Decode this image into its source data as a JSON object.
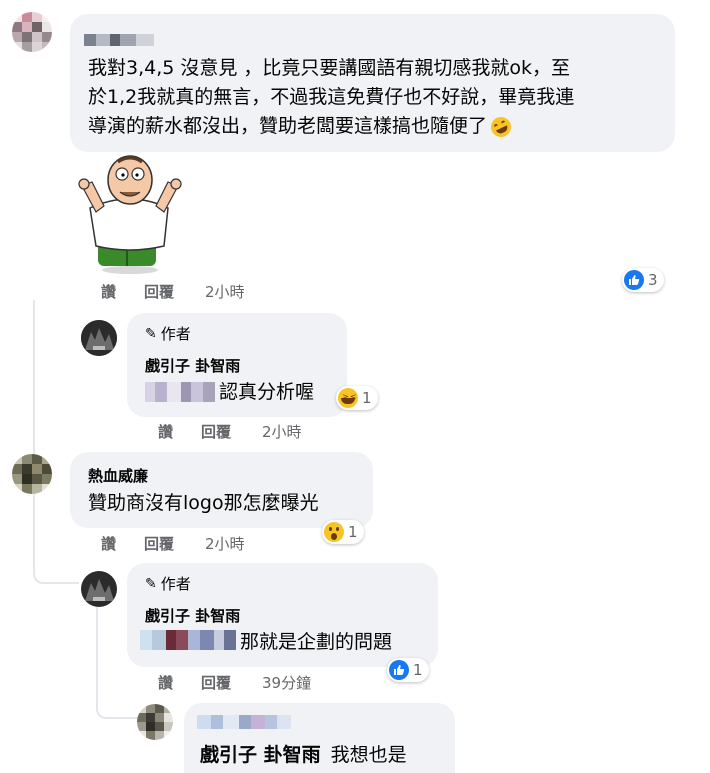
{
  "comments": [
    {
      "name": "",
      "lines": [
        "我對3,4,5 沒意見 ，比竟只要講國語有親切感我就ok，至",
        "於1,2我就真的無言，不過我這免費仔也不好說，畢竟我連",
        "導演的薪水都沒出，贊助老闆要這樣搞也隨便了"
      ],
      "sticker": "peter-griffin-shrug-sticker",
      "like": "讚",
      "reply": "回覆",
      "time": "2小時",
      "reaction_icon": "like-icon",
      "reaction_count": "3"
    },
    {
      "author_tag": "作者",
      "name": "戲引子 卦智雨",
      "text": "認真分析喔",
      "like": "讚",
      "reply": "回覆",
      "time": "2小時",
      "reaction_icon": "laugh-icon",
      "reaction_count": "1"
    },
    {
      "name": "熱血威廉",
      "text": "贊助商沒有logo那怎麼曝光",
      "like": "讚",
      "reply": "回覆",
      "time": "2小時",
      "reaction_icon": "wow-icon",
      "reaction_count": "1"
    },
    {
      "author_tag": "作者",
      "name": "戲引子 卦智雨",
      "text": "那就是企劃的問題",
      "like": "讚",
      "reply": "回覆",
      "time": "39分鐘",
      "reaction_icon": "like-icon",
      "reaction_count": "1"
    },
    {
      "mention": "戲引子 卦智雨",
      "text": "我想也是"
    }
  ],
  "colors": {
    "bubble": "#f0f2f5",
    "like_blue": "#1877f2",
    "meta_gray": "#65676b"
  }
}
